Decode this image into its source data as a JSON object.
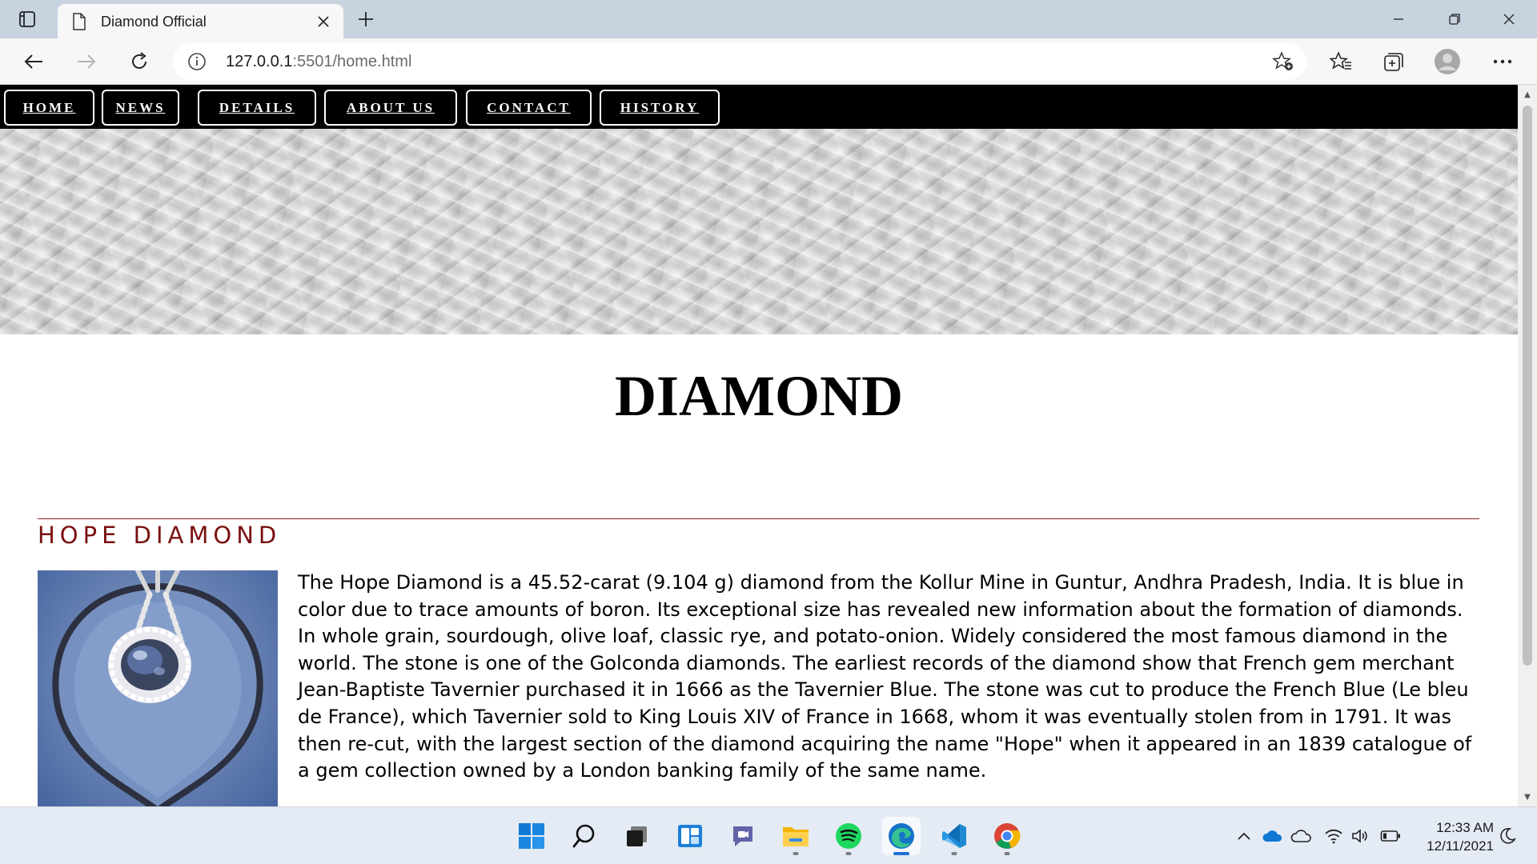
{
  "browser": {
    "tab_title": "Diamond Official",
    "url_host": "127.0.0.1",
    "url_rest": ":5501/home.html"
  },
  "site": {
    "nav": [
      "HOME",
      "NEWS",
      "DETAILS",
      "ABOUT US",
      "CONTACT",
      "HISTORY"
    ],
    "title": "DIAMOND",
    "section_heading": "HOPE DIAMOND",
    "body": "The Hope Diamond is a 45.52-carat (9.104 g) diamond from the Kollur Mine in Guntur, Andhra Pradesh, India. It is blue in color due to trace amounts of boron. Its exceptional size has revealed new information about the formation of diamonds. In whole grain, sourdough, olive loaf, classic rye, and potato-onion. Widely considered the most famous diamond in the world. The stone is one of the Golconda diamonds. The earliest records of the diamond show that French gem merchant Jean-Baptiste Tavernier purchased it in 1666 as the Tavernier Blue. The stone was cut to produce the French Blue (Le bleu de France), which Tavernier sold to King Louis XIV of France in 1668, whom it was eventually stolen from in 1791. It was then re-cut, with the largest section of the diamond acquiring the name \"Hope\" when it appeared in an 1839 catalogue of a gem collection owned by a London banking family of the same name."
  },
  "taskbar": {
    "apps": [
      "start",
      "search",
      "task-view",
      "widgets",
      "teams-chat",
      "file-explorer",
      "spotify",
      "edge",
      "vscode",
      "chrome"
    ],
    "active_app": "edge",
    "time": "12:33 AM",
    "date": "12/11/2021"
  },
  "colors": {
    "tabstrip": "#c8d3e0",
    "toolbar": "#f7f7f7",
    "nav_bg": "#000000",
    "section_accent": "#7a1010",
    "taskbar": "#e4ebf4"
  }
}
